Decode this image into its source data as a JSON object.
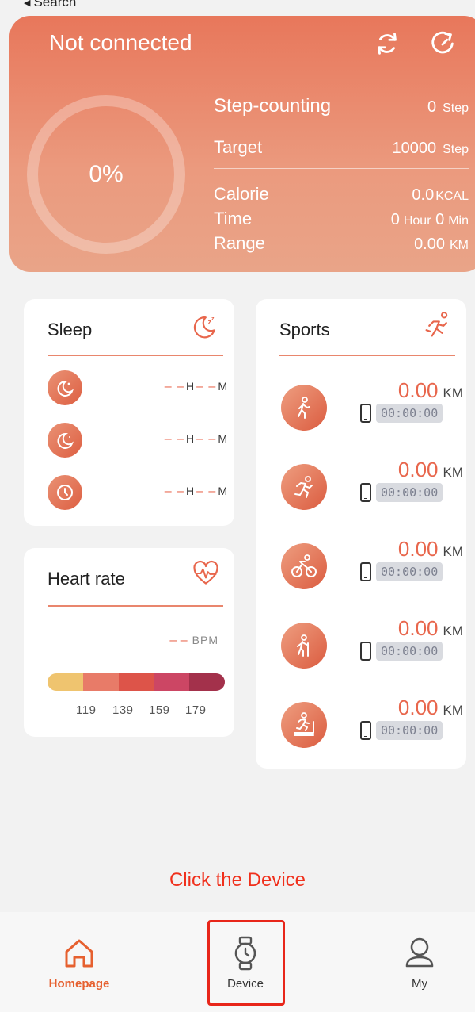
{
  "nav": {
    "back_label": "Search"
  },
  "header": {
    "status": "Not connected",
    "progress_percent_label": "0%",
    "progress_fraction": 0,
    "refresh_icon": "sync-icon",
    "history_icon": "reload-icon",
    "step_counting": {
      "label": "Step-counting",
      "value": "0",
      "unit": "Step"
    },
    "target": {
      "label": "Target",
      "value": "10000",
      "unit": "Step"
    },
    "calorie": {
      "label": "Calorie",
      "value": "0.0",
      "unit": "KCAL"
    },
    "time": {
      "label": "Time",
      "hours": "0",
      "hours_unit": "Hour",
      "minutes": "0",
      "minutes_unit": "Min"
    },
    "range": {
      "label": "Range",
      "value": "0.00",
      "unit": "KM"
    }
  },
  "sleep": {
    "title": "Sleep",
    "title_icon": "moon-zzz-icon",
    "items": [
      {
        "icon": "moon-star-icon",
        "hours": "– –",
        "h_unit": "H",
        "minutes": "– –",
        "m_unit": "M"
      },
      {
        "icon": "moon-icon",
        "hours": "– –",
        "h_unit": "H",
        "minutes": "– –",
        "m_unit": "M"
      },
      {
        "icon": "clock-icon",
        "hours": "– –",
        "h_unit": "H",
        "minutes": "– –",
        "m_unit": "M"
      }
    ]
  },
  "heart_rate": {
    "title": "Heart rate",
    "title_icon": "heart-pulse-icon",
    "value": "– –",
    "unit": "BPM",
    "zones": [
      {
        "color": "#efc46f"
      },
      {
        "color": "#e87b68"
      },
      {
        "color": "#dd5449"
      },
      {
        "color": "#cc4664"
      },
      {
        "color": "#a3314b"
      }
    ],
    "ticks": [
      "119",
      "139",
      "159",
      "179"
    ]
  },
  "sports": {
    "title": "Sports",
    "title_icon": "runner-icon",
    "items": [
      {
        "icon": "walk-icon",
        "distance": "0.00",
        "unit": "KM",
        "time": "00:00:00"
      },
      {
        "icon": "run-icon",
        "distance": "0.00",
        "unit": "KM",
        "time": "00:00:00"
      },
      {
        "icon": "cycling-icon",
        "distance": "0.00",
        "unit": "KM",
        "time": "00:00:00"
      },
      {
        "icon": "climb-icon",
        "distance": "0.00",
        "unit": "KM",
        "time": "00:00:00"
      },
      {
        "icon": "treadmill-icon",
        "distance": "0.00",
        "unit": "KM",
        "time": "00:00:00"
      }
    ]
  },
  "hint": "Click the Device",
  "tabbar": {
    "tabs": [
      {
        "label": "Homepage",
        "icon": "home-icon",
        "active": true
      },
      {
        "label": "Device",
        "icon": "watch-icon",
        "active": false
      },
      {
        "label": "My",
        "icon": "user-icon",
        "active": false
      }
    ]
  },
  "colors": {
    "accent": "#e8664c",
    "hint": "#f0301c",
    "highlight": "#e8261a",
    "active_tab": "#e6602f"
  }
}
